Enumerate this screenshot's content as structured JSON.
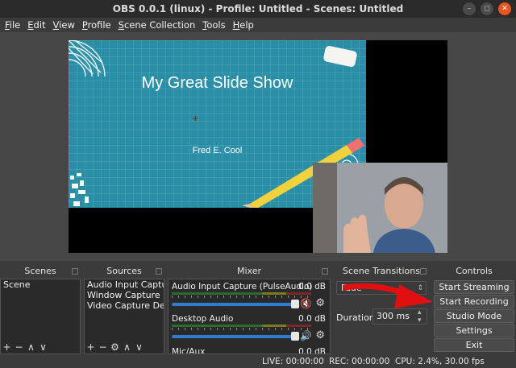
{
  "window": {
    "title": "OBS 0.0.1 (linux) - Profile: Untitled - Scenes: Untitled",
    "minimize": "–",
    "maximize": "◻",
    "close": "✕"
  },
  "menu": {
    "items": [
      {
        "u": "F",
        "rest": "ile"
      },
      {
        "u": "E",
        "rest": "dit"
      },
      {
        "u": "V",
        "rest": "iew"
      },
      {
        "u": "P",
        "rest": "rofile"
      },
      {
        "u": "S",
        "rest": "cene Collection"
      },
      {
        "u": "T",
        "rest": "ools"
      },
      {
        "u": "H",
        "rest": "elp"
      }
    ]
  },
  "preview": {
    "slide_title": "My Great Slide Show",
    "slide_author": "Fred E. Cool"
  },
  "scenes": {
    "title": "Scenes",
    "items": [
      "Scene"
    ],
    "toolbar": [
      "+",
      "−",
      "∧",
      "∨"
    ]
  },
  "sources": {
    "title": "Sources",
    "items": [
      "Audio Input Captur",
      "Window Capture (X",
      "Video Capture Dev"
    ],
    "toolbar": [
      "+",
      "−",
      "⚙",
      "∧",
      "∨"
    ]
  },
  "mixer": {
    "title": "Mixer",
    "tracks": [
      {
        "name": "Audio Input Capture (PulseAudio)",
        "db": "0.0 dB",
        "muted": true,
        "level": 0.92
      },
      {
        "name": "Desktop Audio",
        "db": "0.0 dB",
        "muted": false,
        "level": 0.92
      },
      {
        "name": "Mic/Aux",
        "db": "0.0 dB"
      }
    ]
  },
  "transitions": {
    "title": "Scene Transitions",
    "selected": "Fade",
    "duration_label": "Duration",
    "duration_value": "300 ms"
  },
  "controls": {
    "title": "Controls",
    "buttons": [
      "Start Streaming",
      "Start Recording",
      "Studio Mode",
      "Settings",
      "Exit"
    ]
  },
  "status": {
    "live": "LIVE: 00:00:00",
    "rec": "REC: 00:00:00",
    "cpu": "CPU: 2.4%, 30.00 fps"
  },
  "colors": {
    "accent_slider": "#2e7bd1",
    "mute_red": "#e03030",
    "annotation_arrow": "#e01010",
    "slide_bg": "#2a8ea6"
  }
}
